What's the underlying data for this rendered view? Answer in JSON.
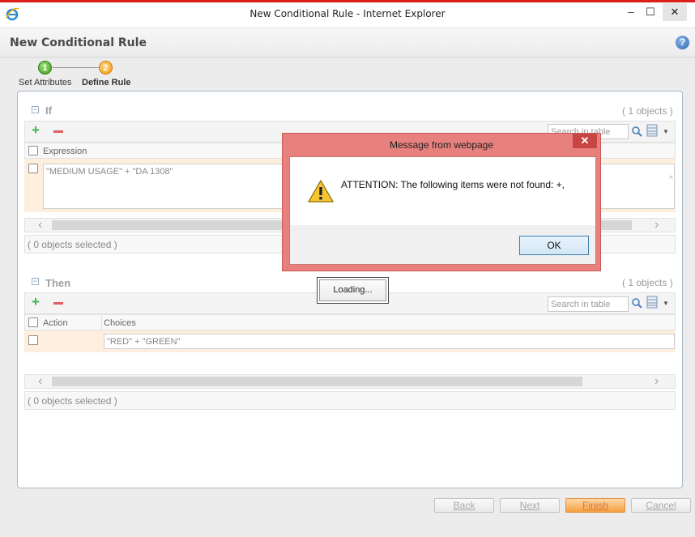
{
  "window": {
    "title": "New Conditional Rule - Internet Explorer",
    "minimize": "–",
    "maximize": "☐",
    "close": "✕"
  },
  "page": {
    "title": "New Conditional Rule",
    "help": "?"
  },
  "wizard": {
    "steps": [
      {
        "number": "1",
        "label": "Set Attributes"
      },
      {
        "number": "2",
        "label": "Define Rule"
      }
    ]
  },
  "if_section": {
    "title": "If",
    "count": "( 1 objects )",
    "search_placeholder": "Search in table",
    "columns": [
      "Expression"
    ],
    "rows": [
      {
        "expression": "\"MEDIUM USAGE\" + \"DA 1308\""
      }
    ],
    "status": "( 0 objects selected )"
  },
  "then_section": {
    "title": "Then",
    "count": "( 1 objects )",
    "search_placeholder": "Search in table",
    "columns": [
      "Action",
      "Choices"
    ],
    "rows": [
      {
        "action": "",
        "choices": "\"RED\" + \"GREEN\""
      }
    ],
    "status": "( 0 objects selected )"
  },
  "buttons": {
    "back": "Back",
    "next": "Next",
    "finish": "Finish",
    "cancel": "Cancel"
  },
  "dialog": {
    "title": "Message from webpage",
    "message": "ATTENTION: The following items were not found: +,",
    "ok": "OK",
    "close": "✕"
  },
  "loading": "Loading..."
}
